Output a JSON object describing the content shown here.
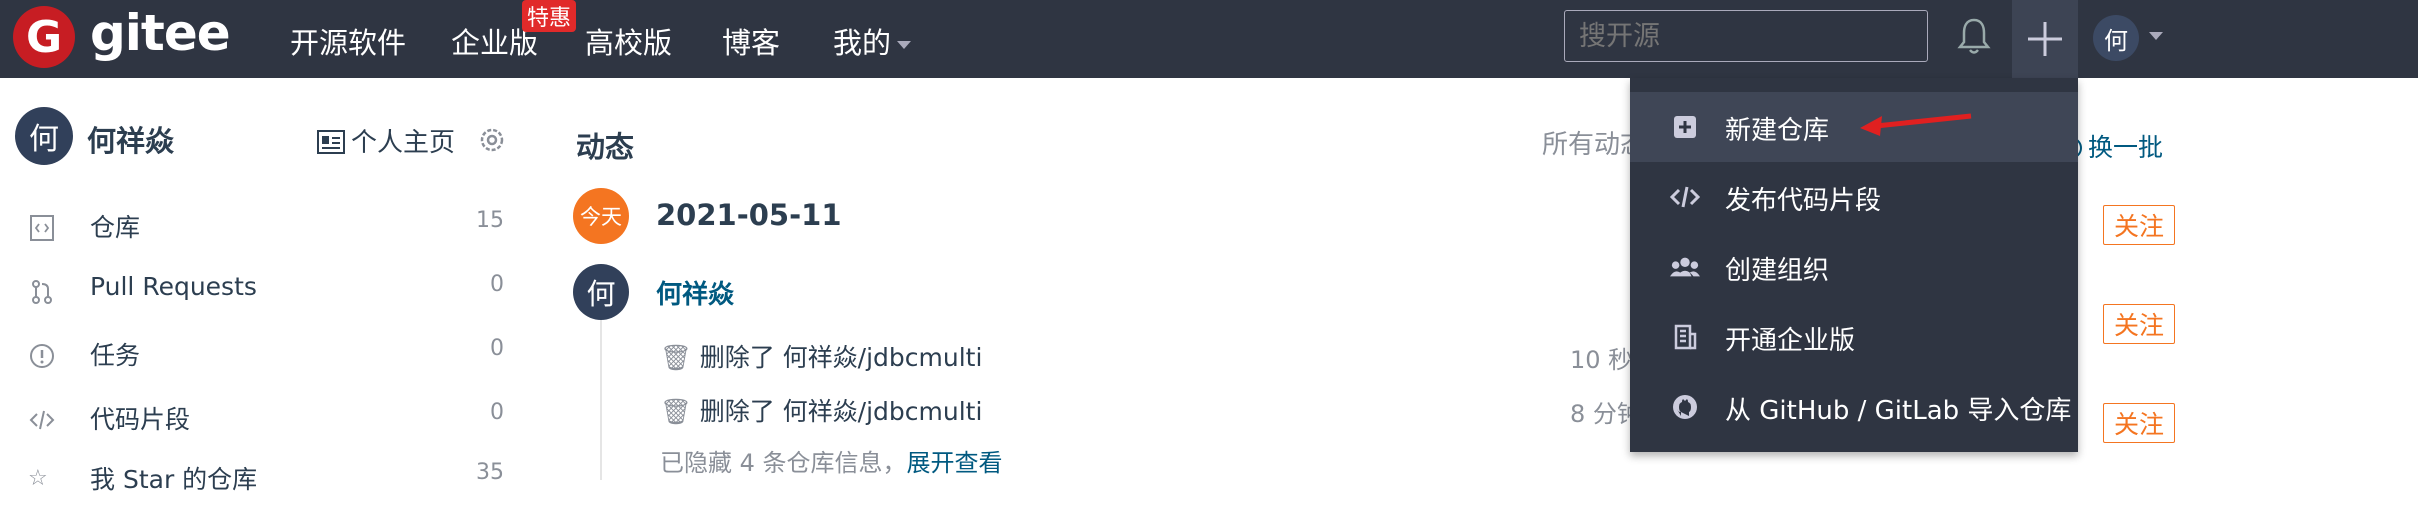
{
  "nav": {
    "logo_letter": "G",
    "logo_text": "gitee",
    "items": [
      "开源软件",
      "企业版",
      "高校版",
      "博客",
      "我的"
    ],
    "badge": "特惠",
    "search_placeholder": "搜开源",
    "avatar_letter": "何"
  },
  "sidebar": {
    "avatar_letter": "何",
    "username": "何祥焱",
    "homepage_label": "个人主页",
    "items": [
      {
        "label": "仓库",
        "count": "15"
      },
      {
        "label": "Pull Requests",
        "count": "0"
      },
      {
        "label": "任务",
        "count": "0"
      },
      {
        "label": "代码片段",
        "count": "0"
      },
      {
        "label": "我 Star 的仓库",
        "count": "35"
      }
    ]
  },
  "feed": {
    "title": "动态",
    "filter_label": "所有动态",
    "today_badge": "今天",
    "date": "2021-05-11",
    "avatar_letter": "何",
    "user": "何祥焱",
    "activities": [
      {
        "text": "删除了 何祥焱/jdbcmulti",
        "time": "10 秒"
      },
      {
        "text": "删除了 何祥焱/jdbcmulti",
        "time": "8 分钟"
      }
    ],
    "hidden_text": "已隐藏 4 条仓库信息，",
    "expand_link": "展开查看"
  },
  "right": {
    "refresh_label": "换一批",
    "follow_label": "关注"
  },
  "dropdown": {
    "items": [
      {
        "label": "新建仓库",
        "icon": "plus-square-icon"
      },
      {
        "label": "发布代码片段",
        "icon": "code-icon"
      },
      {
        "label": "创建组织",
        "icon": "users-icon"
      },
      {
        "label": "开通企业版",
        "icon": "building-icon"
      },
      {
        "label": "从 GitHub / GitLab 导入仓库",
        "icon": "github-icon"
      }
    ]
  },
  "colors": {
    "nav_bg": "#2f3542",
    "brand_red": "#c71d23",
    "accent_orange": "#f47521",
    "link_blue": "#005980",
    "annotation_arrow": "#e02020"
  }
}
